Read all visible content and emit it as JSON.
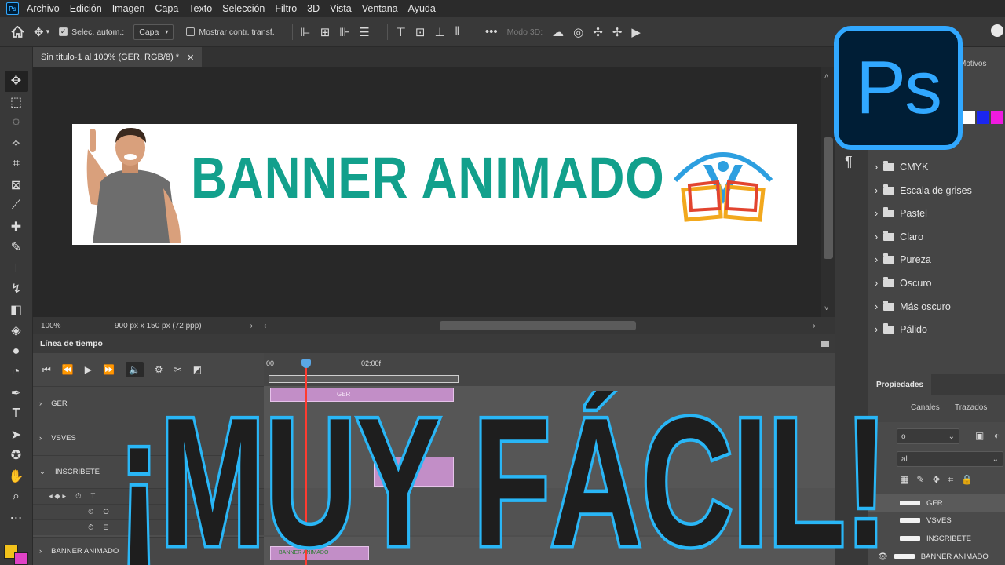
{
  "menu": {
    "app_icon_text": "Ps",
    "items": [
      "Archivo",
      "Edición",
      "Imagen",
      "Capa",
      "Texto",
      "Selección",
      "Filtro",
      "3D",
      "Vista",
      "Ventana",
      "Ayuda"
    ]
  },
  "options": {
    "auto_select_label": "Selec. autom.:",
    "auto_select_checked": true,
    "layer_dropdown": "Capa",
    "show_transform_label": "Mostrar contr. transf.",
    "mode3d_label": "Modo 3D:"
  },
  "document": {
    "tab_title": "Sin título-1 al 100% (GER, RGB/8) *",
    "zoom": "100%",
    "size_info": "900 px x 150 px (72 ppp)"
  },
  "banner": {
    "text": "BANNER ANIMADO",
    "color": "#12a08c"
  },
  "timeline": {
    "title": "Línea de tiempo",
    "ruler_start": "00",
    "ruler_mark": "02:00f",
    "layers": [
      {
        "name": "GER",
        "clip_label": "GER"
      },
      {
        "name": "VSVES"
      },
      {
        "name": "INSCRIBETE"
      },
      {
        "name": "BANNER ANIMADO",
        "clip_label": "BANNER ANIMADO"
      }
    ],
    "sub_rows": [
      "T",
      "O",
      "E"
    ]
  },
  "right_panel": {
    "motivos_tab": "Motivos",
    "pilcrow": "¶",
    "folders": [
      "CMYK",
      "Escala de grises",
      "Pastel",
      "Claro",
      "Pureza",
      "Oscuro",
      "Más oscuro",
      "Pálido"
    ],
    "properties_tab": "Propiedades",
    "layer_tabs": [
      "Canales",
      "Trazados"
    ],
    "dropdown_a": "o",
    "dropdown_b": "al",
    "layers": [
      "GER",
      "VSVES",
      "INSCRIBETE",
      "BANNER ANIMADO"
    ]
  },
  "logo": {
    "text": "Ps",
    "accent": "#31a8ff",
    "bg": "#001e36"
  },
  "overlay": {
    "title": "¡MUY FÁCIL!",
    "fill": "#1e1e1e",
    "stroke": "#29b6f6"
  },
  "colors": {
    "foreground": "#f2c21b",
    "background": "#e042c6"
  }
}
